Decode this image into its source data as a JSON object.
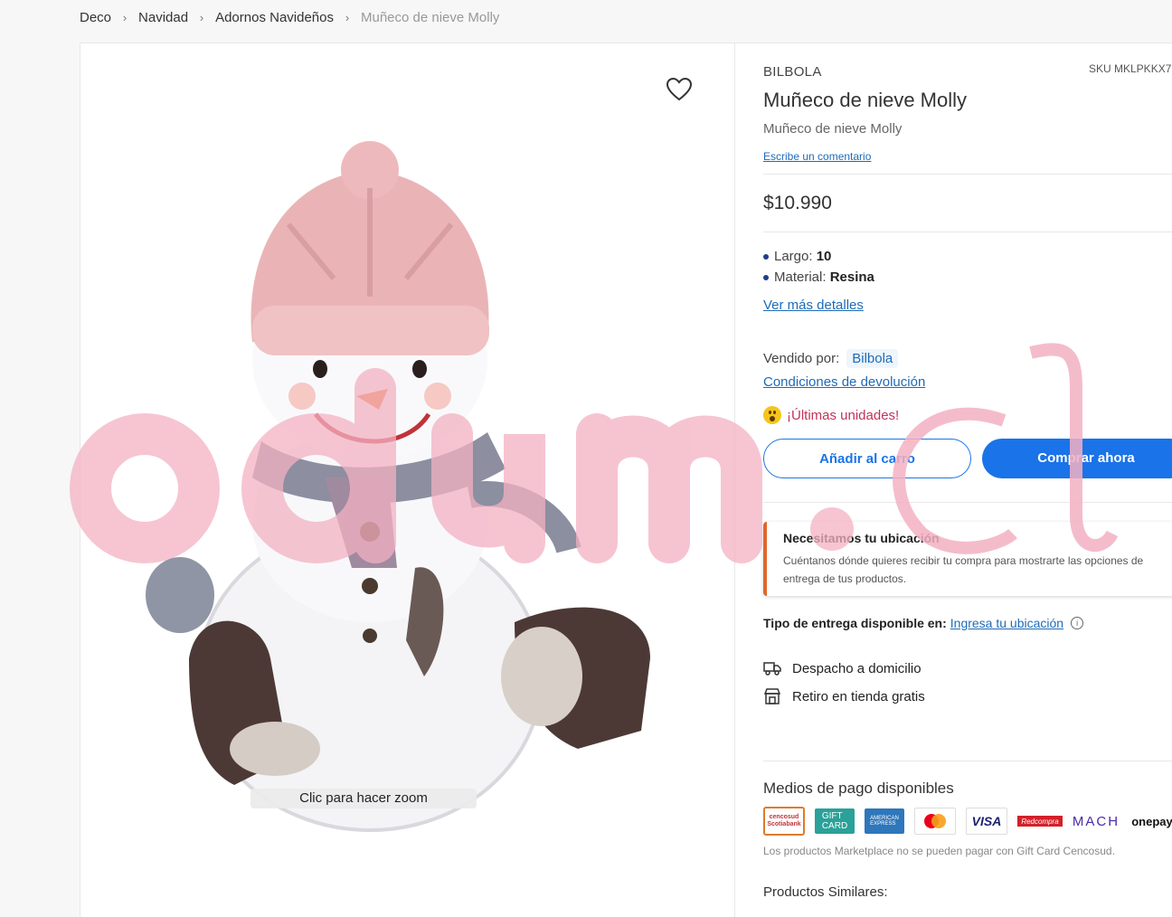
{
  "breadcrumb": {
    "items": [
      "Deco",
      "Navidad",
      "Adornos Navideños"
    ],
    "current": "Muñeco de nieve Molly"
  },
  "gallery": {
    "zoom_hint": "Clic para hacer zoom",
    "watermark": "odum.cl"
  },
  "product": {
    "brand": "BILBOLA",
    "sku": "SKU MKLPKKX7",
    "title": "Muñeco de nieve Molly",
    "subtitle": "Muñeco de nieve Molly",
    "comment_link": "Escribe un comentario",
    "price": "$10.990",
    "attributes": [
      {
        "label": "Largo:",
        "value": "10"
      },
      {
        "label": "Material:",
        "value": "Resina"
      }
    ],
    "more_details": "Ver más detalles",
    "sold_by_label": "Vendido por:",
    "seller": "Bilbola",
    "return_conditions": "Condiciones de devolución",
    "stock_warning": "¡Últimas unidades!"
  },
  "actions": {
    "add_to_cart": "Añadir al carro",
    "buy_now": "Comprar ahora"
  },
  "location": {
    "title": "Necesitamos tu ubicación",
    "description": "Cuéntanos dónde quieres recibir tu compra para mostrarte las opciones de entrega de tus productos."
  },
  "delivery": {
    "label": "Tipo de entrega disponible en:",
    "link": "Ingresa tu ubicación",
    "options": [
      "Despacho a domicilio",
      "Retiro en tienda gratis"
    ]
  },
  "payment": {
    "title": "Medios de pago disponibles",
    "methods": [
      "Cencosud Scotiabank",
      "Gift Card Cencosud",
      "American Express",
      "Mastercard",
      "VISA",
      "Redcompra",
      "MACH",
      "onepay"
    ],
    "note": "Los productos Marketplace no se pueden pagar con Gift Card Cencosud."
  },
  "similar_title": "Productos Similares:",
  "colors": {
    "accent": "#1a73e8",
    "link": "#1e6bb8",
    "warning": "#c0335a",
    "location_border": "#e0662b",
    "watermark": "#f4b6c6"
  }
}
